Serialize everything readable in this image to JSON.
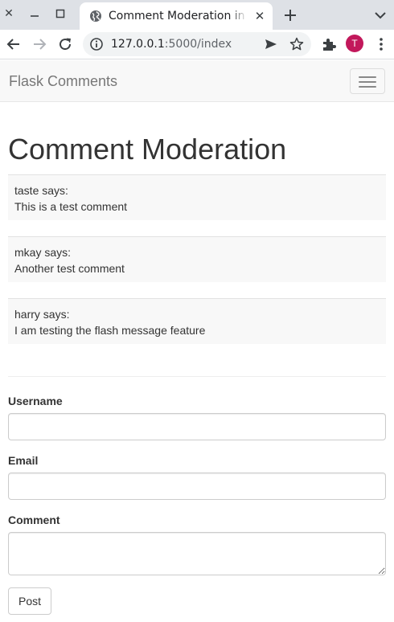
{
  "browser": {
    "tab_title": "Comment Moderation in Flask",
    "url_host": "127.0.0.1",
    "url_path": ":5000/index",
    "avatar_letter": "T",
    "icons": [
      "close-icon",
      "minimize-icon",
      "maximize-icon",
      "globe-icon",
      "tab-close-icon",
      "new-tab-icon",
      "tab-search-icon",
      "back-icon",
      "forward-icon",
      "reload-icon",
      "site-info-icon",
      "send-icon",
      "star-icon",
      "extensions-icon",
      "menu-dots-icon"
    ]
  },
  "navbar": {
    "brand": "Flask Comments",
    "toggle_icon": "hamburger-icon"
  },
  "main": {
    "title": "Comment Moderation",
    "comments": [
      {
        "author_line": "taste says:",
        "text": "This is a test comment"
      },
      {
        "author_line": "mkay says:",
        "text": "Another test comment"
      },
      {
        "author_line": "harry says:",
        "text": "I am testing the flash message feature"
      }
    ]
  },
  "form": {
    "username_label": "Username",
    "username_value": "",
    "email_label": "Email",
    "email_value": "",
    "comment_label": "Comment",
    "comment_value": "",
    "submit_label": "Post"
  },
  "colors": {
    "tabstrip": "#dee1e6",
    "navbar_bg": "#f8f8f8",
    "brand_text": "#777777",
    "avatar_bg": "#c2185b"
  }
}
